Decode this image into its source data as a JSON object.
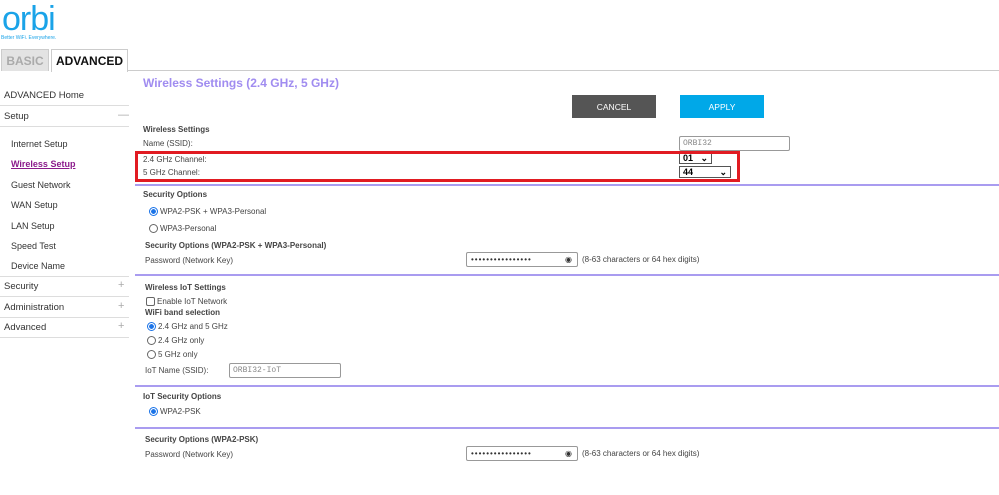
{
  "logo": {
    "text": "orbi",
    "tagline": "Better WiFi. Everywhere."
  },
  "tabs": {
    "basic": "BASIC",
    "advanced": "ADVANCED"
  },
  "sidebar": {
    "home": "ADVANCED Home",
    "setup": "Setup",
    "setup_items": [
      "Internet Setup",
      "Wireless Setup",
      "Guest Network",
      "WAN Setup",
      "LAN Setup",
      "Speed Test",
      "Device Name"
    ],
    "security": "Security",
    "administration": "Administration",
    "advanced": "Advanced",
    "collapse_symbol": "—",
    "expand_symbol": "+"
  },
  "main": {
    "title": "Wireless Settings (2.4 GHz, 5 GHz)",
    "cancel": "CANCEL",
    "apply": "APPLY",
    "wireless_heading": "Wireless Settings",
    "ssid_label": "Name (SSID):",
    "ssid_value": "ORBI32",
    "ch24_label": "2.4 GHz Channel:",
    "ch24_value": "01",
    "ch5_label": "5 GHz Channel:",
    "ch5_value": "44",
    "security_heading": "Security Options",
    "sec_opt1": "WPA2-PSK + WPA3-Personal",
    "sec_opt2": "WPA3-Personal",
    "sec_sub_heading": "Security Options (WPA2-PSK + WPA3-Personal)",
    "pw_label": "Password (Network Key)",
    "pw_mask": "••••••••••••••••",
    "pw_hint": "(8-63 characters or 64 hex digits)",
    "iot_heading": "Wireless IoT Settings",
    "iot_enable": "Enable IoT Network",
    "band_heading": "WiFi band selection",
    "band_opts": [
      "2.4 GHz and 5 GHz",
      "2.4 GHz only",
      "5 GHz only"
    ],
    "iot_name_label": "IoT Name (SSID):",
    "iot_name_value": "ORBI32-IoT",
    "iot_sec_heading": "IoT Security Options",
    "iot_sec_opt": "WPA2-PSK",
    "iot_sec_sub_heading": "Security Options (WPA2-PSK)",
    "iot_pw_label": "Password (Network Key)",
    "iot_pw_mask": "••••••••••••••••",
    "iot_pw_hint": "(8-63 characters or 64 hex digits)"
  },
  "colors": {
    "accent": "#1aa3e8",
    "title": "#a08cf0",
    "highlight": "#e11b22",
    "apply": "#00a8e8",
    "cancel": "#555555"
  }
}
